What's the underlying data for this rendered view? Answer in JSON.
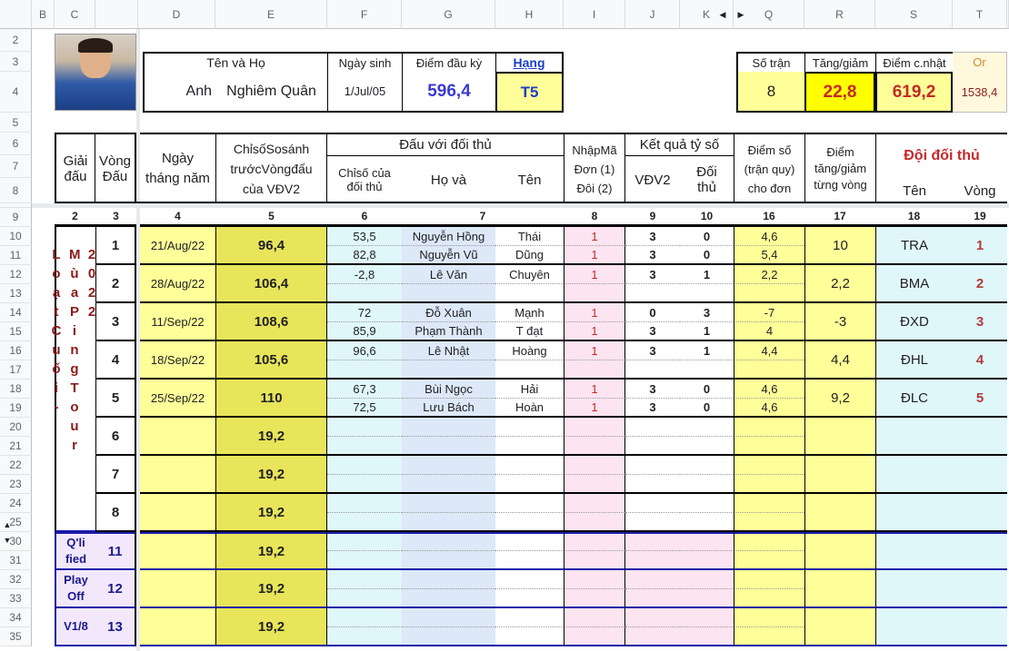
{
  "columns": [
    "B",
    "C",
    "D",
    "E",
    "F",
    "G",
    "H",
    "I",
    "J",
    "K",
    "Q",
    "R",
    "S",
    "T"
  ],
  "rows": [
    "2",
    "3",
    "4",
    "5",
    "6",
    "7",
    "8",
    "9",
    "10",
    "11",
    "12",
    "13",
    "14",
    "15",
    "16",
    "17",
    "18",
    "19",
    "20",
    "21",
    "22",
    "23",
    "24",
    "25",
    "30",
    "31",
    "32",
    "33",
    "34",
    "35"
  ],
  "profile": {
    "label_name": "Tên     và     Họ",
    "first_name": "Anh",
    "full_name": "Nghiêm Quân",
    "label_dob": "Ngày sinh",
    "dob": "1/Jul/05",
    "label_start": "Điểm đầu kỳ",
    "start_points": "596,4",
    "label_rank": "Hạng",
    "rank": "T5"
  },
  "summary": {
    "label_matches": "Số trận",
    "matches": "8",
    "label_change": "Tăng/giảm",
    "change": "22,8",
    "label_updated": "Điểm c.nhật",
    "updated": "619,2",
    "label_or": "Or",
    "or_value": "1538,4"
  },
  "headers": {
    "tournament": "Giải đấu",
    "round": "Vòng Đấu",
    "date": "Ngày tháng năm",
    "compare": "ChỉsốSosánh trướcVòngđấu của VĐV2",
    "vs_opponent": "Đấu với đối thủ",
    "opp_index": "Chỉsố của đối thủ",
    "ho_va": "Họ      và",
    "ten": "Tên",
    "input_code": "NhậpMã Đơn (1) Đôi (2)",
    "score_result": "Kết quả tỷ số",
    "vdv2": "VĐV2",
    "opponent": "Đối thủ",
    "points_single": "Điểm số (trận quy) cho đơn",
    "points_change": "Điểm tăng/giảm từng vòng",
    "opp_team": "Đội đối thủ",
    "team_name": "Tên",
    "team_round": "Vòng"
  },
  "col_numbers": [
    "2",
    "3",
    "4",
    "5",
    "6",
    "7",
    "8",
    "9",
    "10",
    "16",
    "17",
    "18",
    "19"
  ],
  "tournament_label_a": "Loạt Cuối -",
  "tournament_label_b": "Mùa Ping Tour",
  "tournament_label_c": "2022",
  "rounds": [
    {
      "round": "1",
      "date": "21/Aug/22",
      "compare": "96,4",
      "matches": [
        {
          "idx": "53,5",
          "ho": "Nguyễn Hồng",
          "ten": "Thái",
          "code": "1",
          "a": "3",
          "b": "0",
          "pts": "4,6"
        },
        {
          "idx": "82,8",
          "ho": "Nguyễn Vũ",
          "ten": "Dũng",
          "code": "1",
          "a": "3",
          "b": "0",
          "pts": "5,4"
        }
      ],
      "change": "10",
      "team": "TRA",
      "team_round": "1"
    },
    {
      "round": "2",
      "date": "28/Aug/22",
      "compare": "106,4",
      "matches": [
        {
          "idx": "-2,8",
          "ho": "Lê Văn",
          "ten": "Chuyên",
          "code": "1",
          "a": "3",
          "b": "1",
          "pts": "2,2"
        }
      ],
      "change": "2,2",
      "team": "BMA",
      "team_round": "2"
    },
    {
      "round": "3",
      "date": "11/Sep/22",
      "compare": "108,6",
      "matches": [
        {
          "idx": "72",
          "ho": "Đỗ Xuân",
          "ten": "Mạnh",
          "code": "1",
          "a": "0",
          "b": "3",
          "pts": "-7"
        },
        {
          "idx": "85,9",
          "ho": "Phạm Thành",
          "ten": "T đạt",
          "code": "1",
          "a": "3",
          "b": "1",
          "pts": "4"
        }
      ],
      "change": "-3",
      "team": "ĐXD",
      "team_round": "3"
    },
    {
      "round": "4",
      "date": "18/Sep/22",
      "compare": "105,6",
      "matches": [
        {
          "idx": "96,6",
          "ho": "Lê Nhật",
          "ten": "Hoàng",
          "code": "1",
          "a": "3",
          "b": "1",
          "pts": "4,4"
        }
      ],
      "change": "4,4",
      "team": "ĐHL",
      "team_round": "4"
    },
    {
      "round": "5",
      "date": "25/Sep/22",
      "compare": "110",
      "matches": [
        {
          "idx": "67,3",
          "ho": "Bùi Ngọc",
          "ten": "Hải",
          "code": "1",
          "a": "3",
          "b": "0",
          "pts": "4,6"
        },
        {
          "idx": "72,5",
          "ho": "Lưu Bách",
          "ten": "Hoàn",
          "code": "1",
          "a": "3",
          "b": "0",
          "pts": "4,6"
        }
      ],
      "change": "9,2",
      "team": "ĐLC",
      "team_round": "5"
    },
    {
      "round": "6",
      "date": "",
      "compare": "19,2",
      "matches": [],
      "change": "",
      "team": "",
      "team_round": ""
    },
    {
      "round": "7",
      "date": "",
      "compare": "19,2",
      "matches": [],
      "change": "",
      "team": "",
      "team_round": ""
    },
    {
      "round": "8",
      "date": "",
      "compare": "19,2",
      "matches": [],
      "change": "",
      "team": "",
      "team_round": ""
    }
  ],
  "extra_rounds": [
    {
      "label": "Q'li fied",
      "round": "11",
      "compare": "19,2"
    },
    {
      "label": "Play Off",
      "round": "12",
      "compare": "19,2"
    },
    {
      "label": "V1/8",
      "round": "13",
      "compare": "19,2"
    }
  ]
}
